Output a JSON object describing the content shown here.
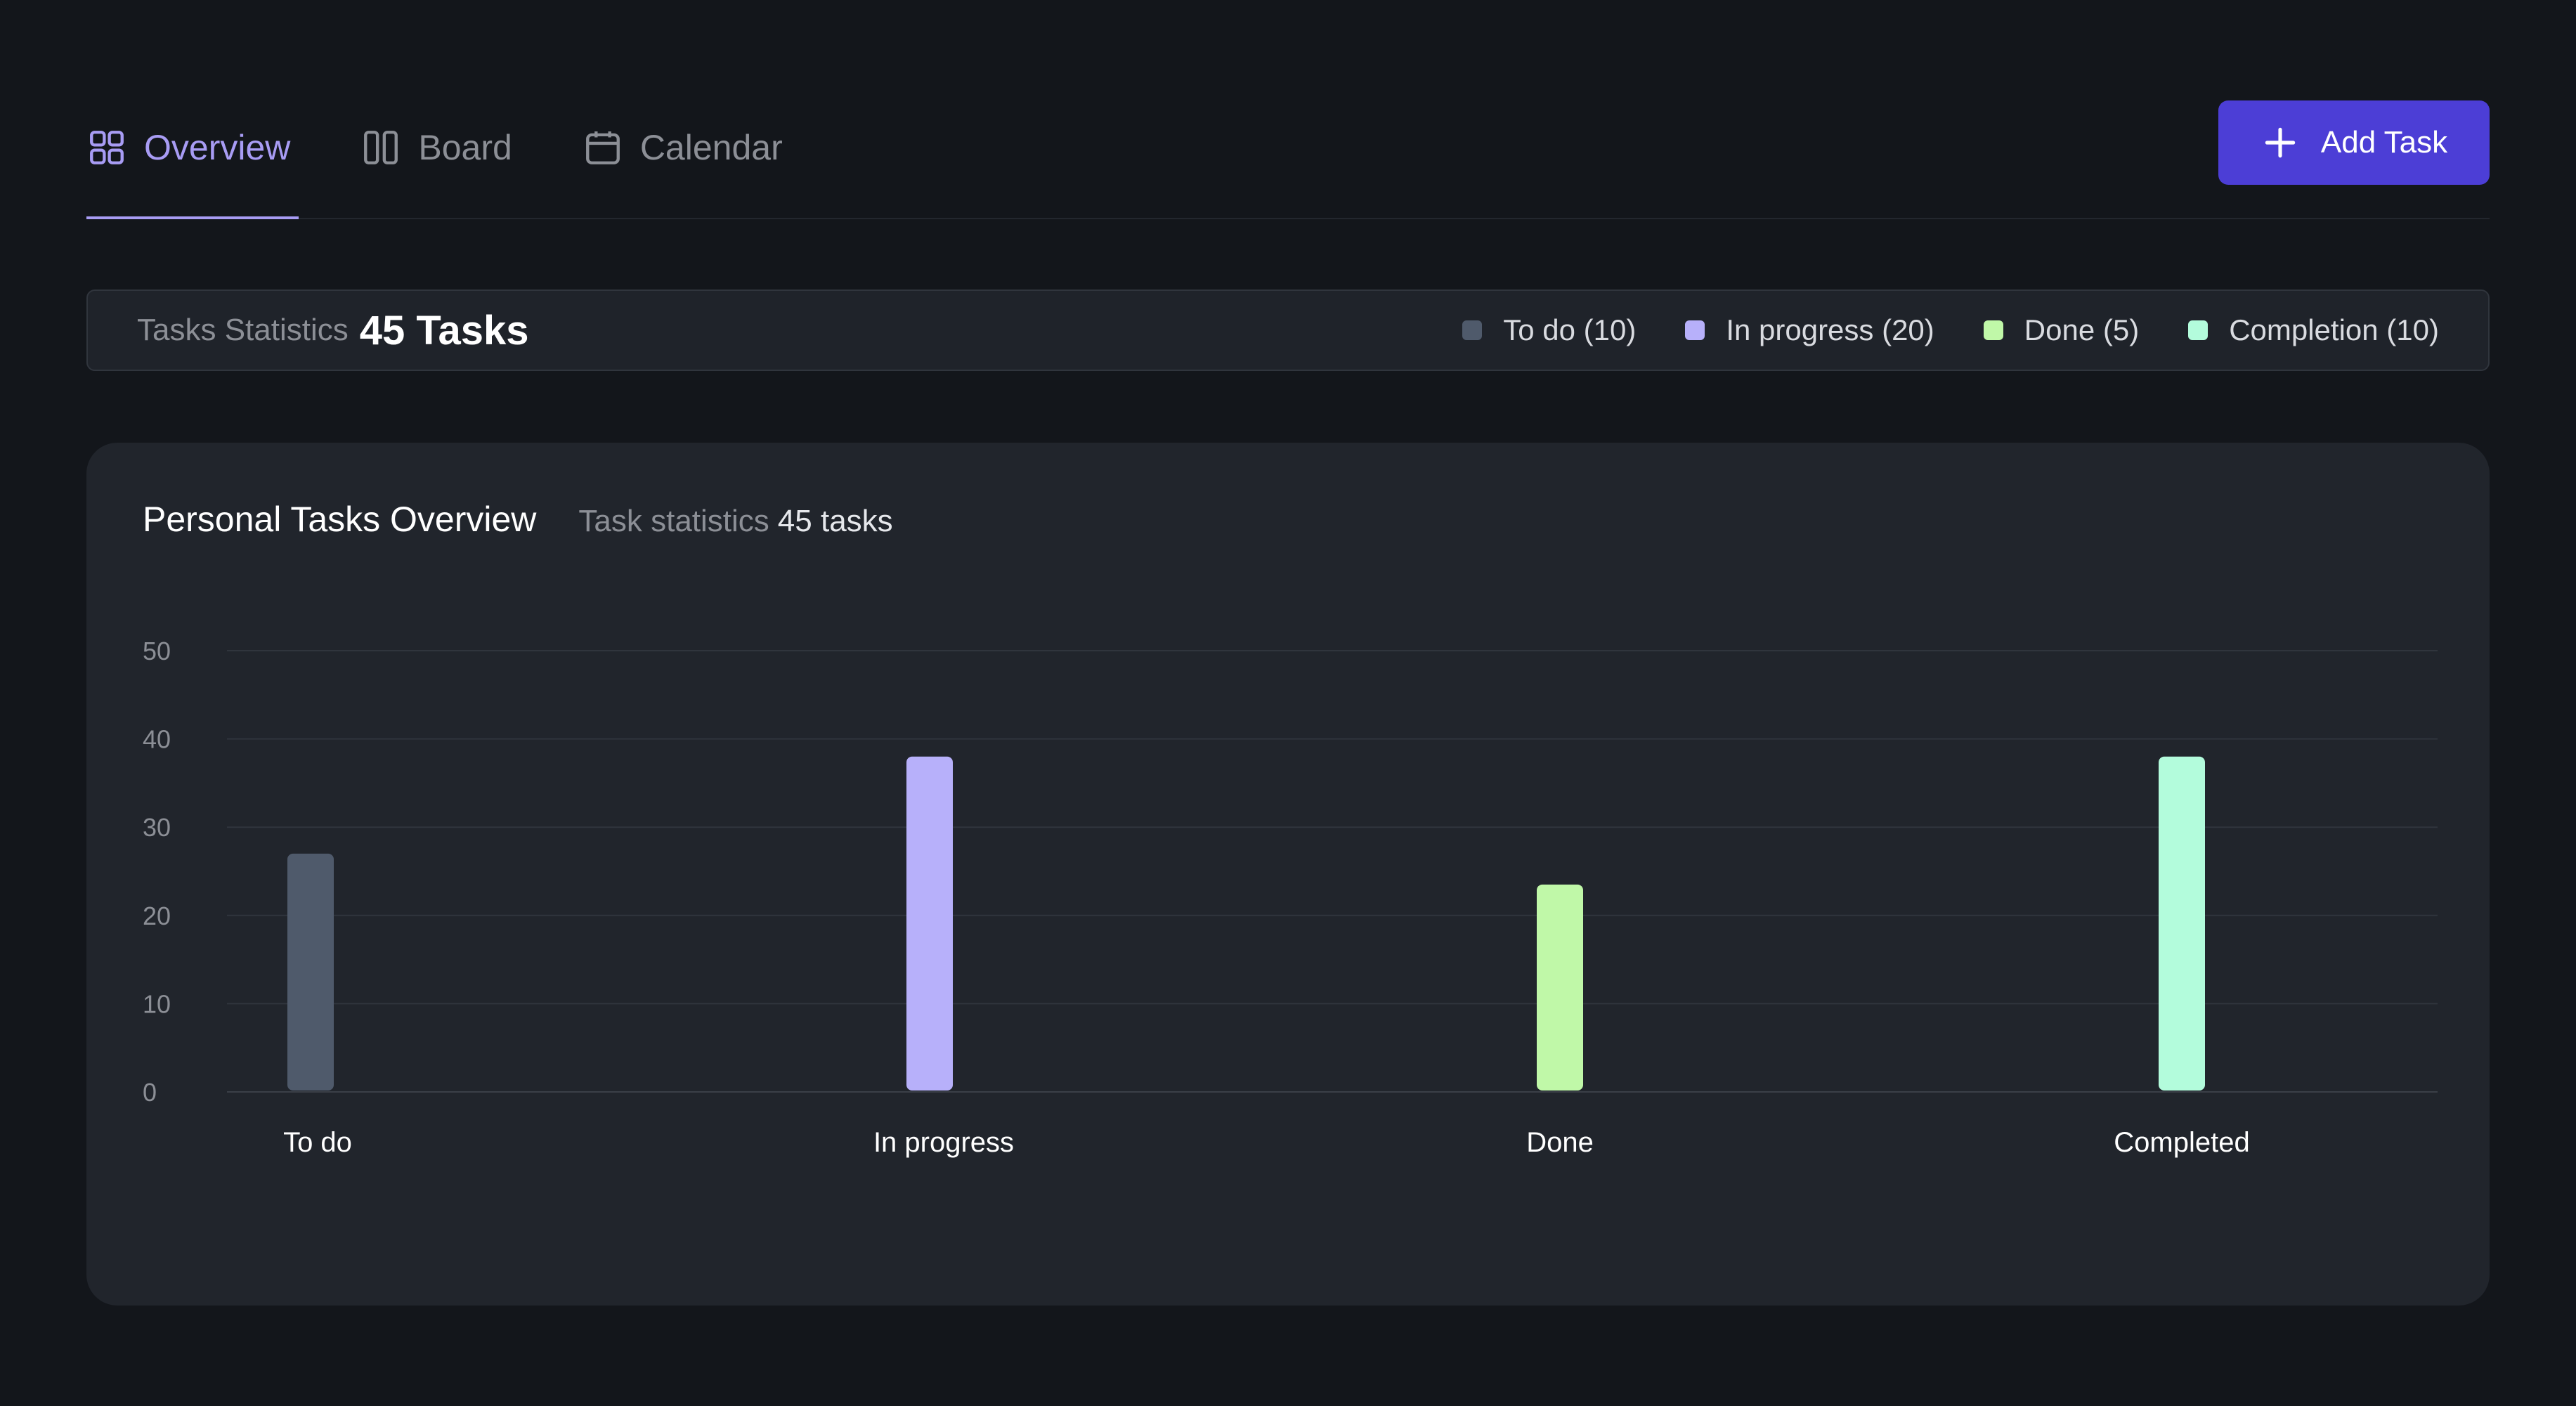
{
  "tabs": [
    {
      "label": "Overview",
      "icon": "grid-icon",
      "active": true
    },
    {
      "label": "Board",
      "icon": "columns-icon",
      "active": false
    },
    {
      "label": "Calendar",
      "icon": "calendar-icon",
      "active": false
    }
  ],
  "add_task": {
    "label": "Add Task",
    "icon": "plus-icon"
  },
  "stats": {
    "label": "Tasks Statistics",
    "count": "45 Tasks",
    "legend": [
      {
        "label": "To do (10)",
        "color": "#4f5a6b"
      },
      {
        "label": "In progress (20)",
        "color": "#b7b0fa"
      },
      {
        "label": "Done (5)",
        "color": "#c0f8a8"
      },
      {
        "label": "Completion (10)",
        "color": "#b3fcdc"
      }
    ]
  },
  "card": {
    "title": "Personal Tasks Overview",
    "sub_label": "Task statistics",
    "sub_count": "45 tasks"
  },
  "chart_data": {
    "type": "bar",
    "categories": [
      "To do",
      "In progress",
      "Done",
      "Completed"
    ],
    "values": [
      27,
      38,
      23.5,
      38
    ],
    "colors": [
      "#4f5a6b",
      "#b7b0fa",
      "#c0f8a8",
      "#b3fcdc"
    ],
    "yticks": [
      "0",
      "10",
      "20",
      "30",
      "40",
      "50"
    ],
    "ylim": [
      0,
      50
    ],
    "grid": true
  }
}
